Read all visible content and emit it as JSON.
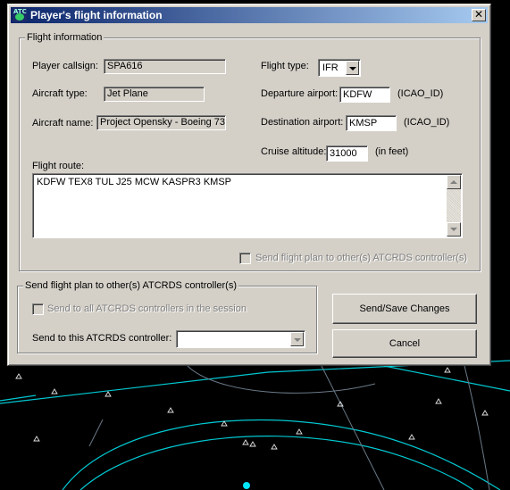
{
  "window": {
    "title": "Player's flight information",
    "app_icon_text": "ATC",
    "close_glyph": "✕"
  },
  "flight_information": {
    "group_title": "Flight information",
    "callsign_label": "Player callsign:",
    "callsign_value": "SPA616",
    "aircraft_type_label": "Aircraft type:",
    "aircraft_type_value": "Jet Plane",
    "aircraft_name_label": "Aircraft name:",
    "aircraft_name_value": "Project Opensky - Boeing 73",
    "flight_type_label": "Flight type:",
    "flight_type_value": "IFR",
    "departure_label": "Departure airport:",
    "departure_value": "KDFW",
    "departure_hint": "(ICAO_ID)",
    "destination_label": "Destination airport:",
    "destination_value": "KMSP",
    "destination_hint": "(ICAO_ID)",
    "cruise_label": "Cruise altitude:",
    "cruise_value": "31000",
    "cruise_hint": "(in feet)",
    "route_label": "Flight route:",
    "route_value": "KDFW TEX8 TUL J25 MCW KASPR3 KMSP",
    "send_checkbox_label": "Send flight plan to other(s) ATCRDS controller(s)",
    "send_checkbox_checked": false
  },
  "send_plan": {
    "group_title": "Send flight plan to other(s) ATCRDS controller(s)",
    "send_all_label": "Send to all ATCRDS controllers in the session",
    "send_all_checked": false,
    "send_to_label": "Send to this ATCRDS controller:",
    "send_to_value": ""
  },
  "buttons": {
    "send_save": "Send/Save Changes",
    "cancel": "Cancel"
  },
  "colors": {
    "radar_line": "#00c8d2",
    "radar_bright": "#00e6ff",
    "dialog_face": "#d4d0c8",
    "title_start": "#0a246a",
    "title_end": "#a6caf0"
  }
}
